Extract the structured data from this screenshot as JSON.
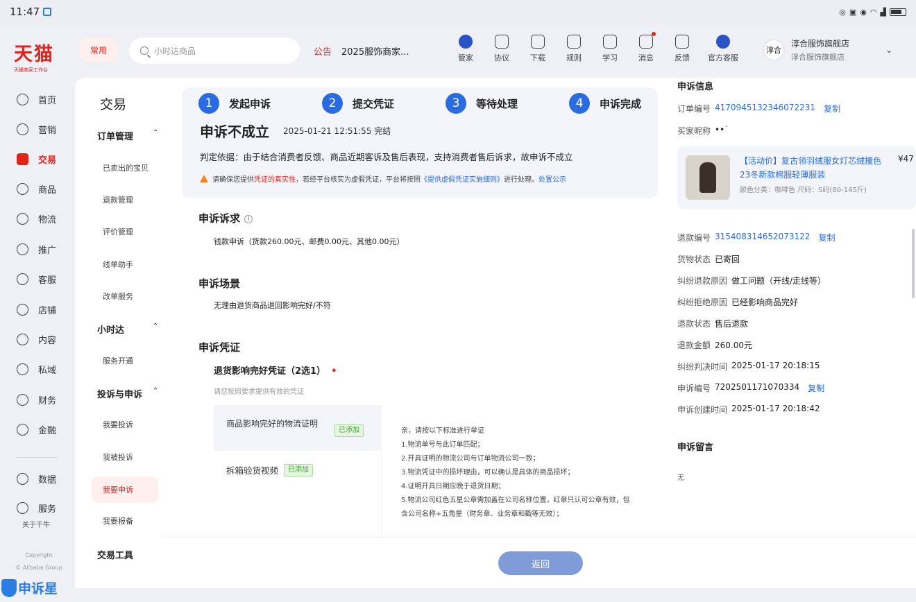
{
  "status": {
    "time": "11:47"
  },
  "brand": {
    "logo": "天猫",
    "sub": "天猫商家工作台"
  },
  "top": {
    "frequent": "常用",
    "search_placeholder": "小时达商品",
    "notice_tag": "公告",
    "notice_text": "2025服饰商家...",
    "nav": [
      "管家",
      "协议",
      "下载",
      "规则",
      "学习",
      "消息",
      "反馈",
      "官方客服"
    ],
    "store_name": "淳合服饰旗舰店",
    "store_sub": "淳合服饰旗舰店",
    "store_avatar": "淳合"
  },
  "rail": {
    "items": [
      "首页",
      "营销",
      "交易",
      "商品",
      "物流",
      "推广",
      "客服",
      "店铺",
      "内容",
      "私域",
      "财务",
      "金融",
      "数据",
      "服务"
    ],
    "active": "交易",
    "extra": "关于千牛",
    "copyright": "Copyright",
    "copyright2": "© Alibaba Group"
  },
  "watermark": "申诉星",
  "subnav": {
    "title": "交易",
    "groups": [
      {
        "name": "订单管理",
        "links": [
          "已卖出的宝贝",
          "退款管理",
          "评价管理",
          "线单助手",
          "改单服务"
        ]
      },
      {
        "name": "小时达",
        "links": [
          "服务开通"
        ]
      },
      {
        "name": "投诉与申诉",
        "links": [
          "我要投诉",
          "我被投诉",
          "我要申诉",
          "我要报备"
        ]
      },
      {
        "name": "交易工具",
        "links": []
      }
    ],
    "active_link": "我要申诉"
  },
  "steps": [
    {
      "num": "1",
      "label": "发起申诉"
    },
    {
      "num": "2",
      "label": "提交凭证"
    },
    {
      "num": "3",
      "label": "等待处理"
    },
    {
      "num": "4",
      "label": "申诉完成"
    }
  ],
  "result": {
    "title": "申诉不成立",
    "time": "2025-01-21 12:51:55 完结",
    "basis": "判定依据：由于结合消费者反馈、商品近期客诉及售后表现，支持消费者售后诉求，故申诉不成立",
    "warn_a": "请确保您提供",
    "warn_b": "凭证的真实性",
    "warn_c": "，若经平台核实为虚假凭证，平台将按照",
    "warn_d": "《提供虚假凭证实施细则》",
    "warn_e": "进行处理。",
    "warn_f": "处置公示"
  },
  "claim": {
    "heading": "申诉诉求",
    "text": "钱款申诉（货款260.00元、邮费0.00元、其他0.00元）"
  },
  "scene": {
    "heading": "申诉场景",
    "text": "无理由退货商品退回影响完好/不符"
  },
  "evidence": {
    "heading": "申诉凭证",
    "sub": "退货影响完好凭证（2选1）",
    "req": "•",
    "hint": "请您按照要求提供有效的凭证",
    "opt1": "商品影响完好的物流证明",
    "opt2": "拆箱验货视频",
    "added": "已添加",
    "rules": [
      "亲，请按以下标准进行举证",
      "1.物流单号与此订单匹配；",
      "2.开具证明的物流公司与订单物流公司一致；",
      "3.物流凭证中的损坏理由，可以确认是具体的商品损坏；",
      "4.证明开具日期应晚于退货日期；",
      "5.物流公司红色五星公章需加盖在公司名称位置，红章只认可公章有效，包含公司名称+五角星（财务章、业务章和戳等无效）；"
    ]
  },
  "right": {
    "header": "申诉信息",
    "order_label": "订单编号",
    "order": "4170945132346072231",
    "copy": "复制",
    "buyer_label": "买家昵称",
    "buyer": "••˙",
    "product_title": "【活动价】复古领羽绒服女灯芯绒撞色23冬新款棉服轻薄服装",
    "price": "¥47",
    "sku": "颜色分类：咖啡色  尺码：S码(80-145斤)",
    "refund_label": "退款编号",
    "refund": "315408314652073122",
    "logistics_label": "货物状态",
    "logistics": "已寄回",
    "reason_label": "纠纷退款原因",
    "reason": "做工问题（开线/走线等）",
    "reject_label": "纠纷拒绝原因",
    "reject": "已经影响商品完好",
    "rstatus_label": "退款状态",
    "rstatus": "售后退款",
    "amount_label": "退款金额",
    "amount": "260.00元",
    "ruling_label": "纠纷判决时间",
    "ruling": "2025-01-17 20:18:15",
    "appeal_label": "申诉编号",
    "appeal": "720250117107033​4",
    "created_label": "申诉创建时间",
    "created": "2025-01-17 20:18:42",
    "msg_header": "申诉留言",
    "msg": "无"
  },
  "footer": {
    "back": "返回"
  }
}
